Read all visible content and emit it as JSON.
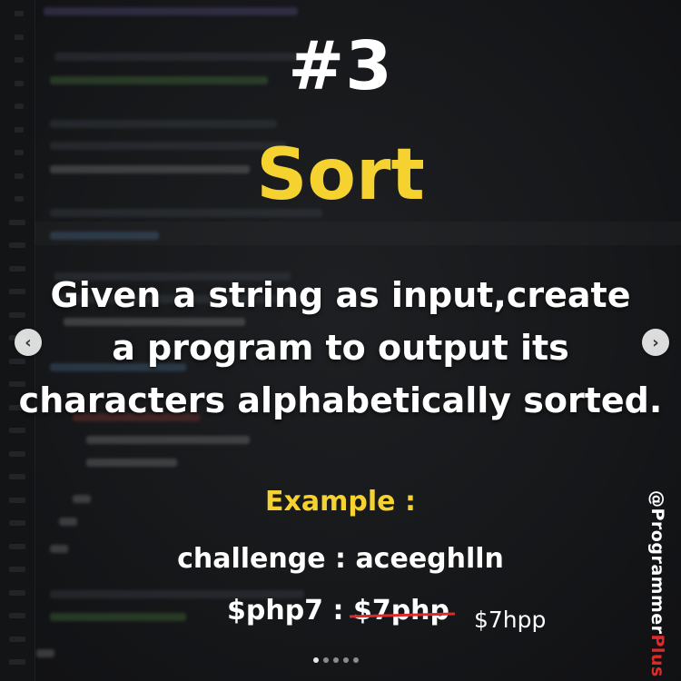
{
  "post": {
    "number": "#3",
    "title": "Sort",
    "description_lines": [
      "Given a string as input,create",
      "a program to output its",
      "characters alphabetically sorted."
    ],
    "example": {
      "title": "Example :",
      "line1": "challenge : aceeghlln",
      "line2_prefix": "$php7 : ",
      "line2_struck": "$7php",
      "answer": "$7hpp"
    },
    "handle": {
      "prefix": "@Programmer",
      "suffix": "Plus"
    }
  },
  "carousel": {
    "prev_label": "‹",
    "next_label": "›",
    "slide_count": 5,
    "active_slide": 1
  },
  "colors": {
    "accent_yellow": "#f6d230",
    "strike_red": "#e02a2a",
    "background": "#1f2123"
  }
}
